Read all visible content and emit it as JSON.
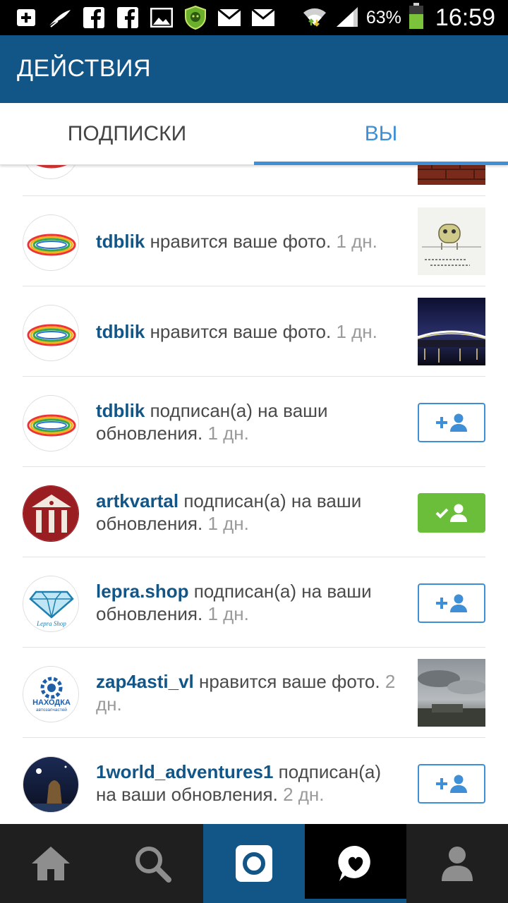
{
  "status_bar": {
    "icons": [
      "plus-box-icon",
      "feather-icon",
      "facebook-icon",
      "facebook-icon",
      "image-icon",
      "shield-badge-icon",
      "mail-icon",
      "mail-icon"
    ],
    "battery_percent": "63%",
    "battery_level": 0.63,
    "time": "16:59"
  },
  "header": {
    "title": "ДЕЙСТВИЯ"
  },
  "tabs": [
    {
      "label": "ПОДПИСКИ",
      "active": false
    },
    {
      "label": "ВЫ",
      "active": true
    }
  ],
  "activity": [
    {
      "username": "tdblik",
      "action": "нравится ваше фото.",
      "time": "1 дн.",
      "avatar": "blik-logo",
      "thumb": "owl-drawing"
    },
    {
      "username": "tdblik",
      "action": "нравится ваше фото.",
      "time": "1 дн.",
      "avatar": "blik-logo",
      "thumb": "night-bridge"
    },
    {
      "username": "tdblik",
      "action": "подписан(а) на ваши обновления.",
      "time": "1 дн.",
      "avatar": "blik-logo",
      "button": "follow"
    },
    {
      "username": "artkvartal",
      "action": "подписан(а) на ваши обновления.",
      "time": "1 дн.",
      "avatar": "artkvartal-logo",
      "button": "following"
    },
    {
      "username": "lepra.shop",
      "action": "подписан(а) на ваши обновления.",
      "time": "1 дн.",
      "avatar": "lepra-logo",
      "avatar_text": "Lepra Shop",
      "button": "follow"
    },
    {
      "username": "zap4asti_vl",
      "action": "нравится ваше фото.",
      "time": "2 дн.",
      "avatar": "nakhodka-logo",
      "avatar_text": "НАХОДКА",
      "avatar_subtext": "автозапчастей",
      "thumb": "cloudy-sky"
    },
    {
      "username": "1world_adventures1",
      "action": "подписан(а) на ваши обновления.",
      "time": "2 дн.",
      "avatar": "night-rock",
      "button": "follow"
    }
  ],
  "bottom_nav": [
    {
      "icon": "home-icon",
      "active": false
    },
    {
      "icon": "search-icon",
      "active": false
    },
    {
      "icon": "camera-icon",
      "active": false
    },
    {
      "icon": "activity-heart-icon",
      "active": true
    },
    {
      "icon": "profile-icon",
      "active": false
    }
  ],
  "colors": {
    "brand": "#125688",
    "tab_active": "#3f8fd6",
    "following_button": "#6bbe3a",
    "username": "#125688",
    "timestamp": "#9a9a9a"
  }
}
